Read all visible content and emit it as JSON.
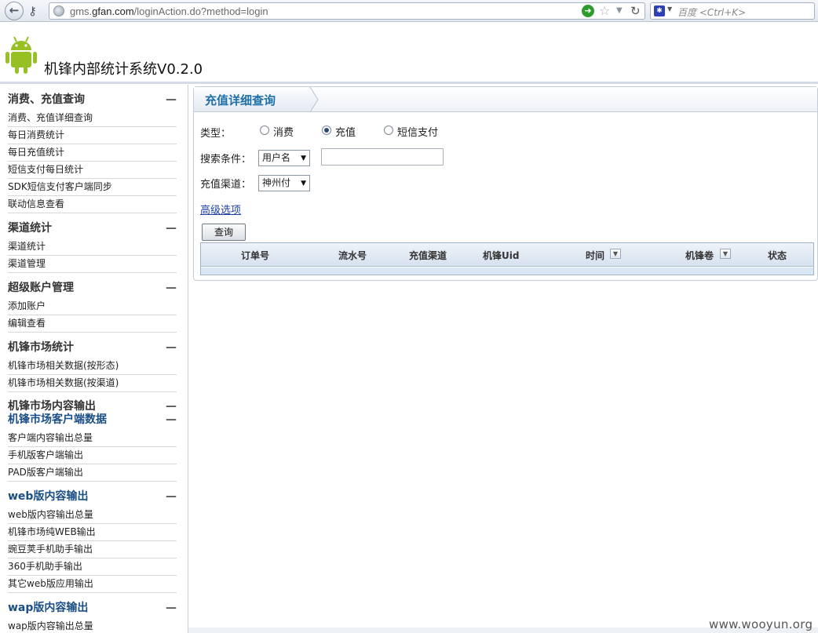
{
  "browser": {
    "url_prefix": "gms.",
    "url_domain": "gfan.com",
    "url_path": "/loginAction.do?method=login",
    "search_placeholder": "百度 <Ctrl+K>"
  },
  "app": {
    "title": "机锋内部统计系统V0.2.0"
  },
  "sidebar": {
    "toggle": "—",
    "groups": [
      {
        "title": "消费、充值查询",
        "items": [
          "消费、充值详细查询",
          "每日消费统计",
          "每日充值统计",
          "短信支付每日统计",
          "SDK短信支付客户端同步",
          "联动信息查看"
        ]
      },
      {
        "title": "渠道统计",
        "items": [
          "渠道统计",
          "渠道管理"
        ]
      },
      {
        "title": "超级账户管理",
        "items": [
          "添加账户",
          "编辑查看"
        ]
      },
      {
        "title": "机锋市场统计",
        "items": [
          "机锋市场相关数据(按形态)",
          "机锋市场相关数据(按渠道)"
        ]
      },
      {
        "title": "机锋市场内容输出",
        "items": []
      },
      {
        "title": "机锋市场客户端数据",
        "items": [
          "客户端内容输出总量",
          "手机版客户端输出",
          "PAD版客户端输出"
        ]
      },
      {
        "title": "web版内容输出",
        "items": [
          "web版内容输出总量",
          "机锋市场纯WEB输出",
          "豌豆荚手机助手输出",
          "360手机助手输出",
          "其它web版应用输出"
        ]
      },
      {
        "title": "wap版内容输出",
        "items": [
          "wap版内容输出总量"
        ]
      }
    ]
  },
  "main": {
    "tab_title": "充值详细查询",
    "type_label": "类型：",
    "type_options": [
      "消费",
      "充值",
      "短信支付"
    ],
    "type_selected": "充值",
    "search_label": "搜索条件：",
    "search_select": "用户名",
    "search_value": "",
    "channel_label": "充值渠道：",
    "channel_select": "神州付",
    "advanced_link": "高级选项",
    "query_button": "查询",
    "columns": [
      "订单号",
      "流水号",
      "充值渠道",
      "机锋Uid",
      "时间",
      "机锋卷",
      "状态"
    ]
  },
  "watermark": "www.wooyun.org"
}
